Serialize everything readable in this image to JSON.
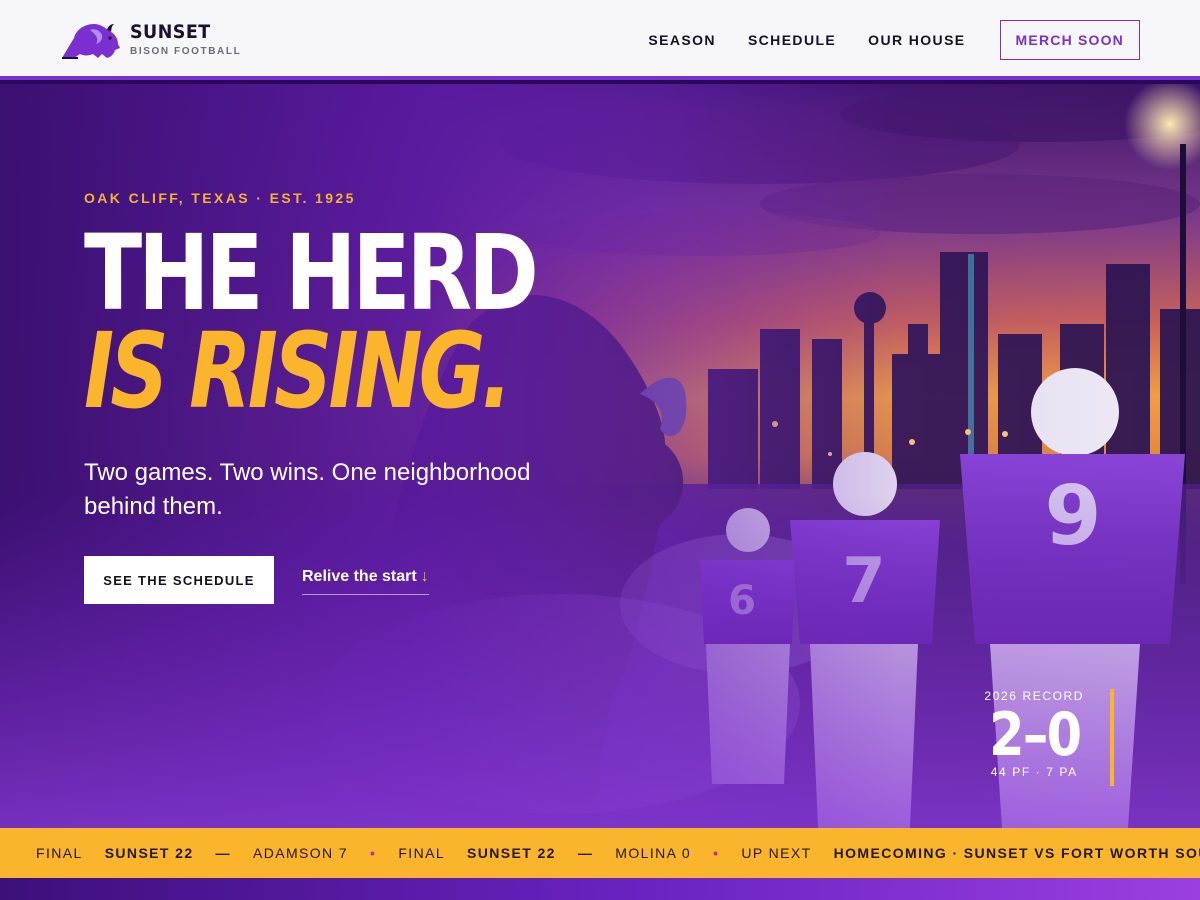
{
  "header": {
    "brand_name": "SUNSET",
    "brand_sub": "BISON FOOTBALL",
    "logo_icon": "bison-icon",
    "nav": [
      {
        "label": "SEASON"
      },
      {
        "label": "SCHEDULE"
      },
      {
        "label": "OUR HOUSE"
      }
    ],
    "cta_label": "MERCH SOON"
  },
  "hero": {
    "eyebrow": "OAK CLIFF, TEXAS · EST. 1925",
    "headline_line1": "THE HERD",
    "headline_line2": "IS RISING.",
    "subheadline": "Two games. Two wins. One neighborhood behind them.",
    "primary_cta": "SEE THE SCHEDULE",
    "secondary_cta": "Relive the start",
    "secondary_cta_icon": "arrow-down-icon",
    "player_numbers": [
      "6",
      "7",
      "9"
    ]
  },
  "record": {
    "label": "2026 RECORD",
    "score": "2–0",
    "detail": "44 PF · 7 PA"
  },
  "ticker": [
    {
      "text": "FINAL",
      "bold": false
    },
    {
      "text": "SUNSET 22",
      "bold": true
    },
    {
      "text": "—",
      "bold": true
    },
    {
      "text": "ADAMSON 7",
      "bold": false
    },
    {
      "text": "•",
      "dot": true
    },
    {
      "text": "FINAL",
      "bold": false
    },
    {
      "text": "SUNSET 22",
      "bold": true
    },
    {
      "text": "—",
      "bold": true
    },
    {
      "text": "MOLINA 0",
      "bold": false
    },
    {
      "text": "•",
      "dot": true
    },
    {
      "text": "UP NEXT",
      "bold": false
    },
    {
      "text": "HOMECOMING · SUNSET VS FORT WORTH SOUTHWEST",
      "bold": true
    }
  ],
  "colors": {
    "purple": "#7b2fd0",
    "gold": "#fbb52c",
    "dark": "#1b1030",
    "header_bg": "#f7f6f9"
  }
}
